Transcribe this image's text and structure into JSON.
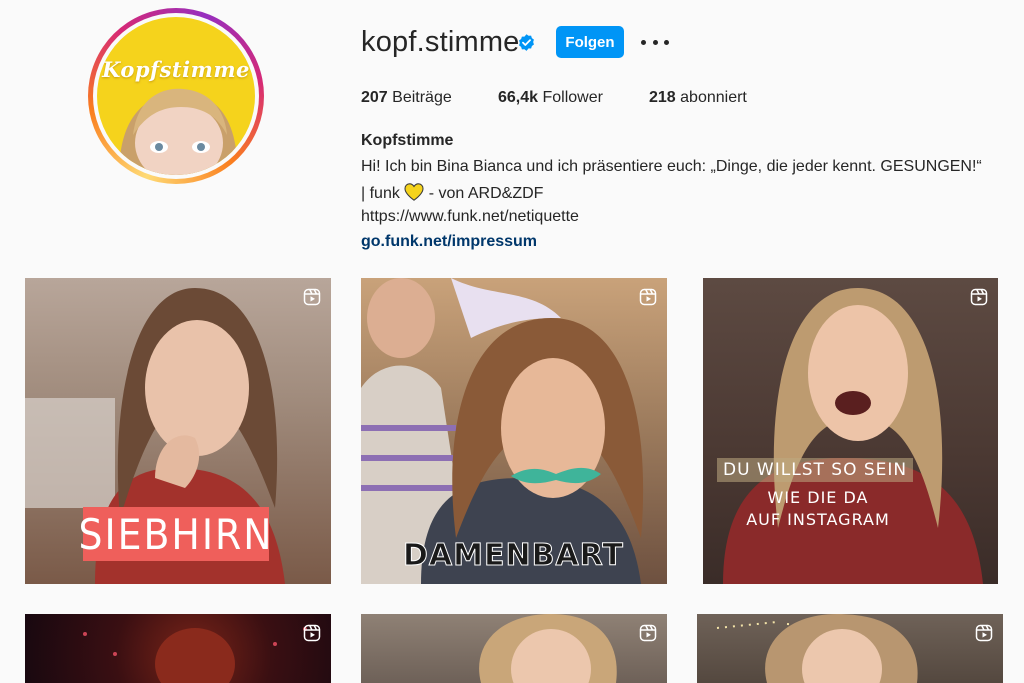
{
  "profile": {
    "username": "kopf.stimme",
    "avatar_text": "Kopfstimme",
    "follow_label": "Folgen",
    "stats": {
      "posts_count": "207",
      "posts_label": "Beiträge",
      "followers_count": "66,4k",
      "followers_label": "Follower",
      "following_count": "218",
      "following_label": "abonniert"
    },
    "full_name": "Kopfstimme",
    "bio_line1": "Hi! Ich bin Bina Bianca und ich präsentiere euch: „Dinge, die jeder kennt. GESUNGEN!“",
    "bio_line2_pre": "| funk",
    "bio_line2_post": "- von ARD&ZDF",
    "bio_line3": "https://www.funk.net/netiquette",
    "bio_link": "go.funk.net/impressum"
  },
  "colors": {
    "follow_button": "#0095f6",
    "verified_badge": "#0095f6",
    "link": "#00376b",
    "avatar_bg": "#f5d31c",
    "heart": "#f5d31c"
  },
  "posts": [
    {
      "caption": "SIEBHIRN",
      "type": "reel"
    },
    {
      "caption": "DAMENBART",
      "type": "reel"
    },
    {
      "caption_line1": "DU WILLST SO SEIN",
      "caption_line2": "WIE DIE DA",
      "caption_line3": "AUF INSTAGRAM",
      "type": "reel"
    },
    {
      "type": "reel"
    },
    {
      "type": "reel"
    },
    {
      "type": "reel"
    }
  ],
  "icons": [
    "verified-badge-icon",
    "more-options-icon",
    "yellow-heart-icon",
    "reel-icon"
  ]
}
